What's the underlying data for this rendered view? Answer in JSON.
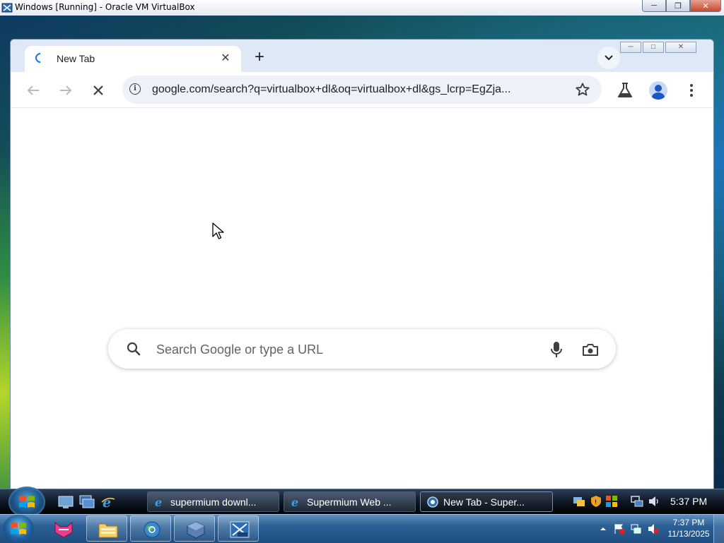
{
  "host_window": {
    "title": "Windows [Running] - Oracle VM VirtualBox"
  },
  "browser": {
    "tabs": [
      {
        "title": "New Tab",
        "loading": true
      }
    ],
    "new_tab_label": "+",
    "toolbar": {
      "url": "google.com/search?q=virtualbox+dl&oq=virtualbox+dl&gs_lcrp=EgZja..."
    },
    "ntp": {
      "search_placeholder": "Search Google or type a URL"
    }
  },
  "guest_taskbar": {
    "tasks": [
      {
        "label": "supermium downl...",
        "icon": "ie-icon"
      },
      {
        "label": "Supermium Web ...",
        "icon": "ie-icon"
      },
      {
        "label": "New Tab - Super...",
        "icon": "supermium-icon",
        "active": true
      }
    ],
    "clock": "5:37 PM"
  },
  "host_taskbar": {
    "time": "7:37 PM",
    "date": "11/13/2025"
  },
  "colors": {
    "accent": "#1a73e8",
    "tab_strip": "#dfe8f7",
    "omnibox": "#eef2f8"
  }
}
